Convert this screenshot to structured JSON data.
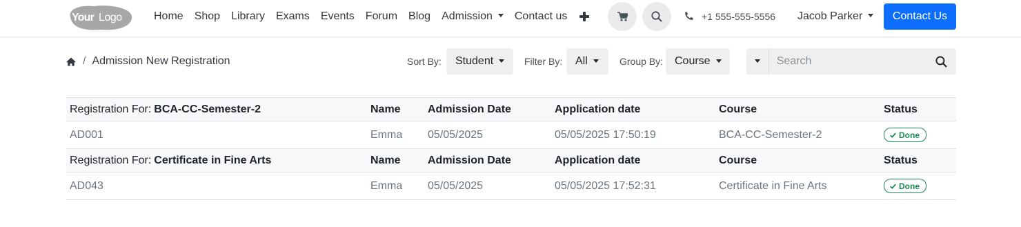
{
  "header": {
    "logo_text": "YourLogo",
    "nav": [
      {
        "label": "Home"
      },
      {
        "label": "Shop"
      },
      {
        "label": "Library"
      },
      {
        "label": "Exams"
      },
      {
        "label": "Events"
      },
      {
        "label": "Forum"
      },
      {
        "label": "Blog"
      },
      {
        "label": "Admission",
        "dropdown": true
      },
      {
        "label": "Contact us"
      }
    ],
    "phone": "+1 555-555-5556",
    "user_name": "Jacob Parker",
    "cta_label": "Contact Us",
    "accent_color": "#0d6efd"
  },
  "toolbar": {
    "breadcrumb_current": "Admission New Registration",
    "sort_label": "Sort By:",
    "sort_value": "Student",
    "filter_label": "Filter By:",
    "filter_value": "All",
    "group_label": "Group By:",
    "group_value": "Course",
    "search_placeholder": "Search"
  },
  "table": {
    "group_prefix": "Registration For:",
    "columns": [
      "Name",
      "Admission Date",
      "Application date",
      "Course",
      "Status"
    ],
    "groups": [
      {
        "name": "BCA-CC-Semester-2",
        "rows": [
          {
            "id": "AD001",
            "name": "Emma",
            "admission_date": "05/05/2025",
            "application_date": "05/05/2025 17:50:19",
            "course": "BCA-CC-Semester-2",
            "status": "Done"
          }
        ]
      },
      {
        "name": "Certificate in Fine Arts",
        "rows": [
          {
            "id": "AD043",
            "name": "Emma",
            "admission_date": "05/05/2025",
            "application_date": "05/05/2025 17:52:31",
            "course": "Certificate in Fine Arts",
            "status": "Done"
          }
        ]
      }
    ],
    "status_color": "#198754"
  }
}
